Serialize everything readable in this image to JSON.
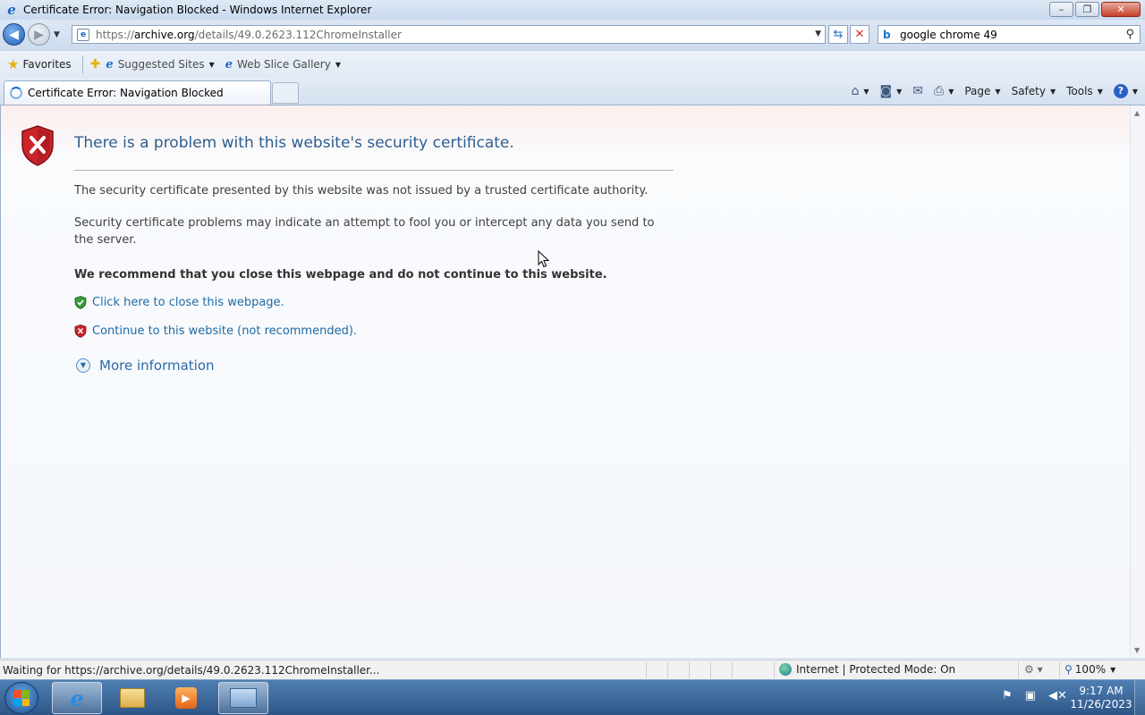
{
  "window": {
    "title": "Certificate Error: Navigation Blocked - Windows Internet Explorer",
    "controls": {
      "minimize": "–",
      "restore": "❐",
      "close": "✕"
    }
  },
  "address_bar": {
    "url_prefix": "https://",
    "url_domain": "archive.org",
    "url_path": "/details/49.0.2623.112ChromeInstaller"
  },
  "search": {
    "value": "google chrome 49"
  },
  "favorites_bar": {
    "favorites_label": "Favorites",
    "links": [
      {
        "label": "Suggested Sites"
      },
      {
        "label": "Web Slice Gallery"
      }
    ]
  },
  "tabs": [
    {
      "label": "Certificate Error: Navigation Blocked"
    }
  ],
  "command_bar": {
    "page_label": "Page",
    "safety_label": "Safety",
    "tools_label": "Tools",
    "help_glyph": "?"
  },
  "error_page": {
    "heading": "There is a problem with this website's security certificate.",
    "paragraph1": "The security certificate presented by this website was not issued by a trusted certificate authority.",
    "paragraph2": "Security certificate problems may indicate an attempt to fool you or intercept any data you send to the server.",
    "recommendation": "We recommend that you close this webpage and do not continue to this website.",
    "close_link": "Click here to close this webpage.",
    "continue_link": "Continue to this website (not recommended).",
    "more_info": "More information"
  },
  "status_bar": {
    "status_text": "Waiting for https://archive.org/details/49.0.2623.112ChromeInstaller...",
    "zone_text": "Internet | Protected Mode: On",
    "zoom_text": "100%"
  },
  "taskbar": {
    "clock_time": "9:17 AM",
    "clock_date": "11/26/2023"
  },
  "colors": {
    "heading": "#2e5e8f",
    "link": "#1f6aa5",
    "shield_red": "#c8242a",
    "shield_green": "#3b9a3b",
    "taskbar": "#2d5687"
  }
}
